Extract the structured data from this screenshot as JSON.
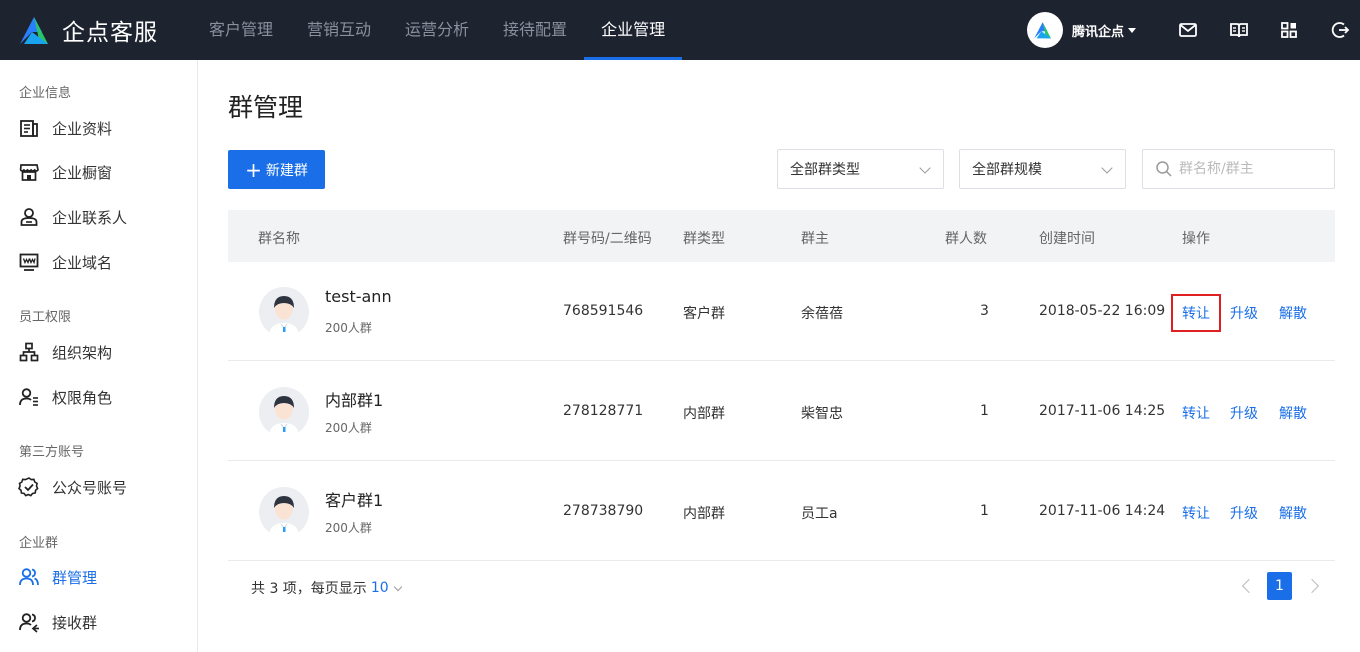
{
  "brand": {
    "name": "企点客服"
  },
  "nav": [
    {
      "label": "客户管理",
      "active": false
    },
    {
      "label": "营销互动",
      "active": false
    },
    {
      "label": "运营分析",
      "active": false
    },
    {
      "label": "接待配置",
      "active": false
    },
    {
      "label": "企业管理",
      "active": true
    }
  ],
  "user": {
    "name": "腾讯企点"
  },
  "sidebar": {
    "groups": [
      {
        "title": "企业信息",
        "items": [
          {
            "label": "企业资料",
            "icon": "document-icon"
          },
          {
            "label": "企业橱窗",
            "icon": "shop-icon"
          },
          {
            "label": "企业联系人",
            "icon": "contact-icon"
          },
          {
            "label": "企业域名",
            "icon": "domain-icon"
          }
        ]
      },
      {
        "title": "员工权限",
        "items": [
          {
            "label": "组织架构",
            "icon": "org-chart-icon"
          },
          {
            "label": "权限角色",
            "icon": "role-icon"
          }
        ]
      },
      {
        "title": "第三方账号",
        "items": [
          {
            "label": "公众号账号",
            "icon": "verified-icon"
          }
        ]
      },
      {
        "title": "企业群",
        "items": [
          {
            "label": "群管理",
            "icon": "group-icon",
            "active": true
          },
          {
            "label": "接收群",
            "icon": "receive-group-icon"
          }
        ]
      }
    ]
  },
  "main": {
    "title": "群管理",
    "new_button": "新建群",
    "filter_type": "全部群类型",
    "filter_size": "全部群规模",
    "search_placeholder": "群名称/群主",
    "columns": [
      "群名称",
      "群号码/二维码",
      "群类型",
      "群主",
      "群人数",
      "创建时间",
      "操作"
    ],
    "rows": [
      {
        "name": "test-ann",
        "capacity": "200人群",
        "number": "768591546",
        "type": "客户群",
        "owner": "余蓓蓓",
        "members": "3",
        "created": "2018-05-22 16:09",
        "ops": [
          "转让",
          "升级",
          "解散"
        ]
      },
      {
        "name": "内部群1",
        "capacity": "200人群",
        "number": "278128771",
        "type": "内部群",
        "owner": "柴智忠",
        "members": "1",
        "created": "2017-11-06 14:25",
        "ops": [
          "转让",
          "升级",
          "解散"
        ]
      },
      {
        "name": "客户群1",
        "capacity": "200人群",
        "number": "278738790",
        "type": "内部群",
        "owner": "员工a",
        "members": "1",
        "created": "2017-11-06 14:24",
        "ops": [
          "转让",
          "升级",
          "解散"
        ]
      }
    ],
    "pagination": {
      "total_text": "共 3 项，每页显示",
      "page_size": "10",
      "current": "1"
    }
  },
  "colors": {
    "topbar": "#1e2330",
    "accent": "#1a6fe8",
    "highlight": "#e02020"
  }
}
